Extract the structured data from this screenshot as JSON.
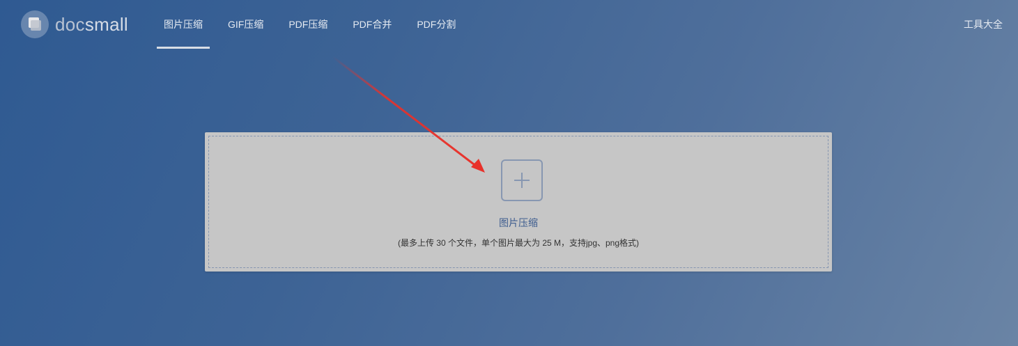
{
  "logo": {
    "text_doc": "doc",
    "text_small": "small"
  },
  "nav": {
    "items": [
      {
        "label": "图片压缩",
        "active": true
      },
      {
        "label": "GIF压缩"
      },
      {
        "label": "PDF压缩"
      },
      {
        "label": "PDF合并"
      },
      {
        "label": "PDF分割"
      }
    ],
    "tools_label": "工具大全"
  },
  "upload": {
    "title": "图片压缩",
    "hint": "(最多上传 30 个文件，单个图片最大为 25 M，支持jpg、png格式)",
    "icon": "plus-icon"
  },
  "annotation": {
    "arrow_color": "#e8312a"
  }
}
